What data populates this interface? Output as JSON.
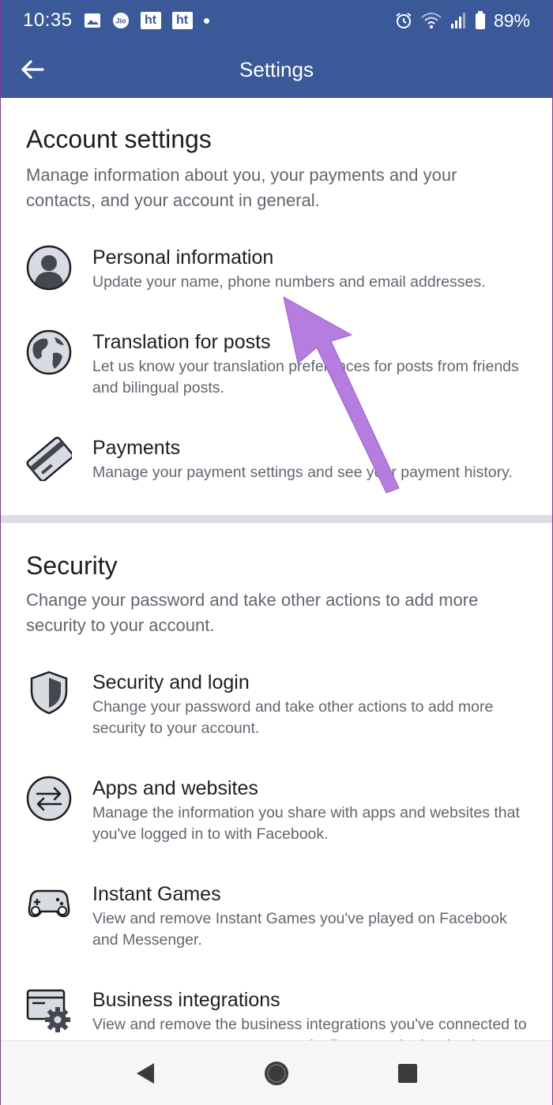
{
  "status_bar": {
    "time": "10:35",
    "ht_label_1": "ht",
    "ht_label_2": "ht",
    "battery": "89%"
  },
  "header": {
    "title": "Settings"
  },
  "account_settings": {
    "title": "Account settings",
    "description": "Manage information about you, your payments and your contacts, and your account in general.",
    "items": [
      {
        "title": "Personal information",
        "description": "Update your name, phone numbers and email addresses.",
        "icon": "person-icon"
      },
      {
        "title": "Translation for posts",
        "description": "Let us know your translation preferences for posts from friends and bilingual posts.",
        "icon": "globe-icon"
      },
      {
        "title": "Payments",
        "description": "Manage your payment settings and see your payment history.",
        "icon": "credit-card-icon"
      }
    ]
  },
  "security": {
    "title": "Security",
    "description": "Change your password and take other actions to add more security to your account.",
    "items": [
      {
        "title": "Security and login",
        "description": "Change your password and take other actions to add more security to your account.",
        "icon": "shield-icon"
      },
      {
        "title": "Apps and websites",
        "description": "Manage the information you share with apps and websites that you've logged in to with Facebook.",
        "icon": "swap-arrows-icon"
      },
      {
        "title": "Instant Games",
        "description": "View and remove Instant Games you've played on Facebook and Messenger.",
        "icon": "gamepad-icon"
      },
      {
        "title": "Business integrations",
        "description": "View and remove the business integrations you've connected to your account to manage your ads, Pages and other business information.",
        "icon": "window-gear-icon"
      }
    ]
  },
  "colors": {
    "brand": "#3b5998",
    "annotation_arrow": "#b57de0",
    "text_primary": "#1c1e21",
    "text_secondary": "#606770"
  }
}
